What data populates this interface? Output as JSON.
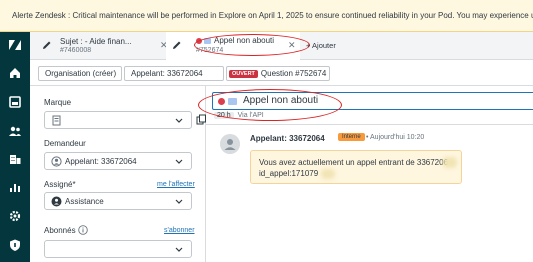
{
  "alert": {
    "text": "Alerte Zendesk : Critical maintenance will be performed in Explore on April 1, 2025 to ensure continued reliability in your Pod. You may experience up to 1.5 ho"
  },
  "tabs": [
    {
      "line1": "Sujet :  - Aide finan...",
      "line2": "#7460008"
    },
    {
      "line1": "Appel non abouti",
      "line2": "#752674"
    }
  ],
  "add_tab_label": "+ Ajouter",
  "breadcrumb": {
    "organisation": "Organisation (créer)",
    "requester": "Appelant: 33672064",
    "status_badge": "OUVERT",
    "ticket": "Question #752674"
  },
  "sidebar": {
    "marque_label": "Marque",
    "demandeur_label": "Demandeur",
    "demandeur_value": "Appelant: 33672064",
    "assigne_label": "Assigné*",
    "assign_me_link": "me l'affecter",
    "assigne_value": "Assistance",
    "abonnes_label": "Abonnés",
    "subscribe_link": "s'abonner"
  },
  "ticket": {
    "subject": "Appel non abouti",
    "age_badge": "20 h",
    "via": "Via l'API"
  },
  "comment": {
    "author": "Appelant: 33672064",
    "badge": "Interne",
    "time": "Aujourd'hui 10:20",
    "line1": "Vous avez actuellement un appel entrant de 3367206",
    "line2": "id_appel:171079"
  },
  "colors": {
    "rail": "#03363d",
    "accent": "#1f73b7",
    "status_open": "#cc3340",
    "internal_badge": "#f79a3e",
    "annotation": "#dd2222"
  }
}
